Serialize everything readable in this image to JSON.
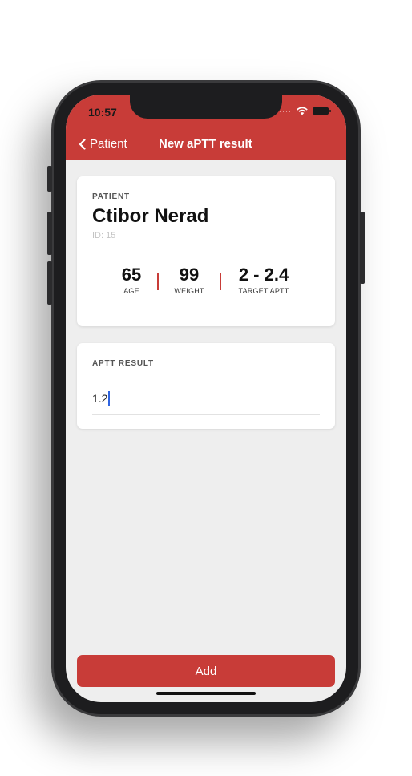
{
  "status_bar": {
    "time": "10:57"
  },
  "nav": {
    "back_label": "Patient",
    "title": "New aPTT result"
  },
  "patient_card": {
    "section_label": "PATIENT",
    "name": "Ctibor Nerad",
    "id_text": "ID: 15",
    "stats": [
      {
        "value": "65",
        "label": "AGE"
      },
      {
        "value": "99",
        "label": "WEIGHT"
      },
      {
        "value": "2 - 2.4",
        "label": "TARGET APTT"
      }
    ]
  },
  "result_card": {
    "section_label": "APTT RESULT",
    "input_value": "1.2"
  },
  "footer": {
    "add_label": "Add"
  },
  "colors": {
    "accent": "#c83c38",
    "background": "#eeeeee",
    "caret": "#2f64e0"
  },
  "icons": [
    "chevron-left-icon",
    "wifi-icon",
    "battery-icon"
  ]
}
